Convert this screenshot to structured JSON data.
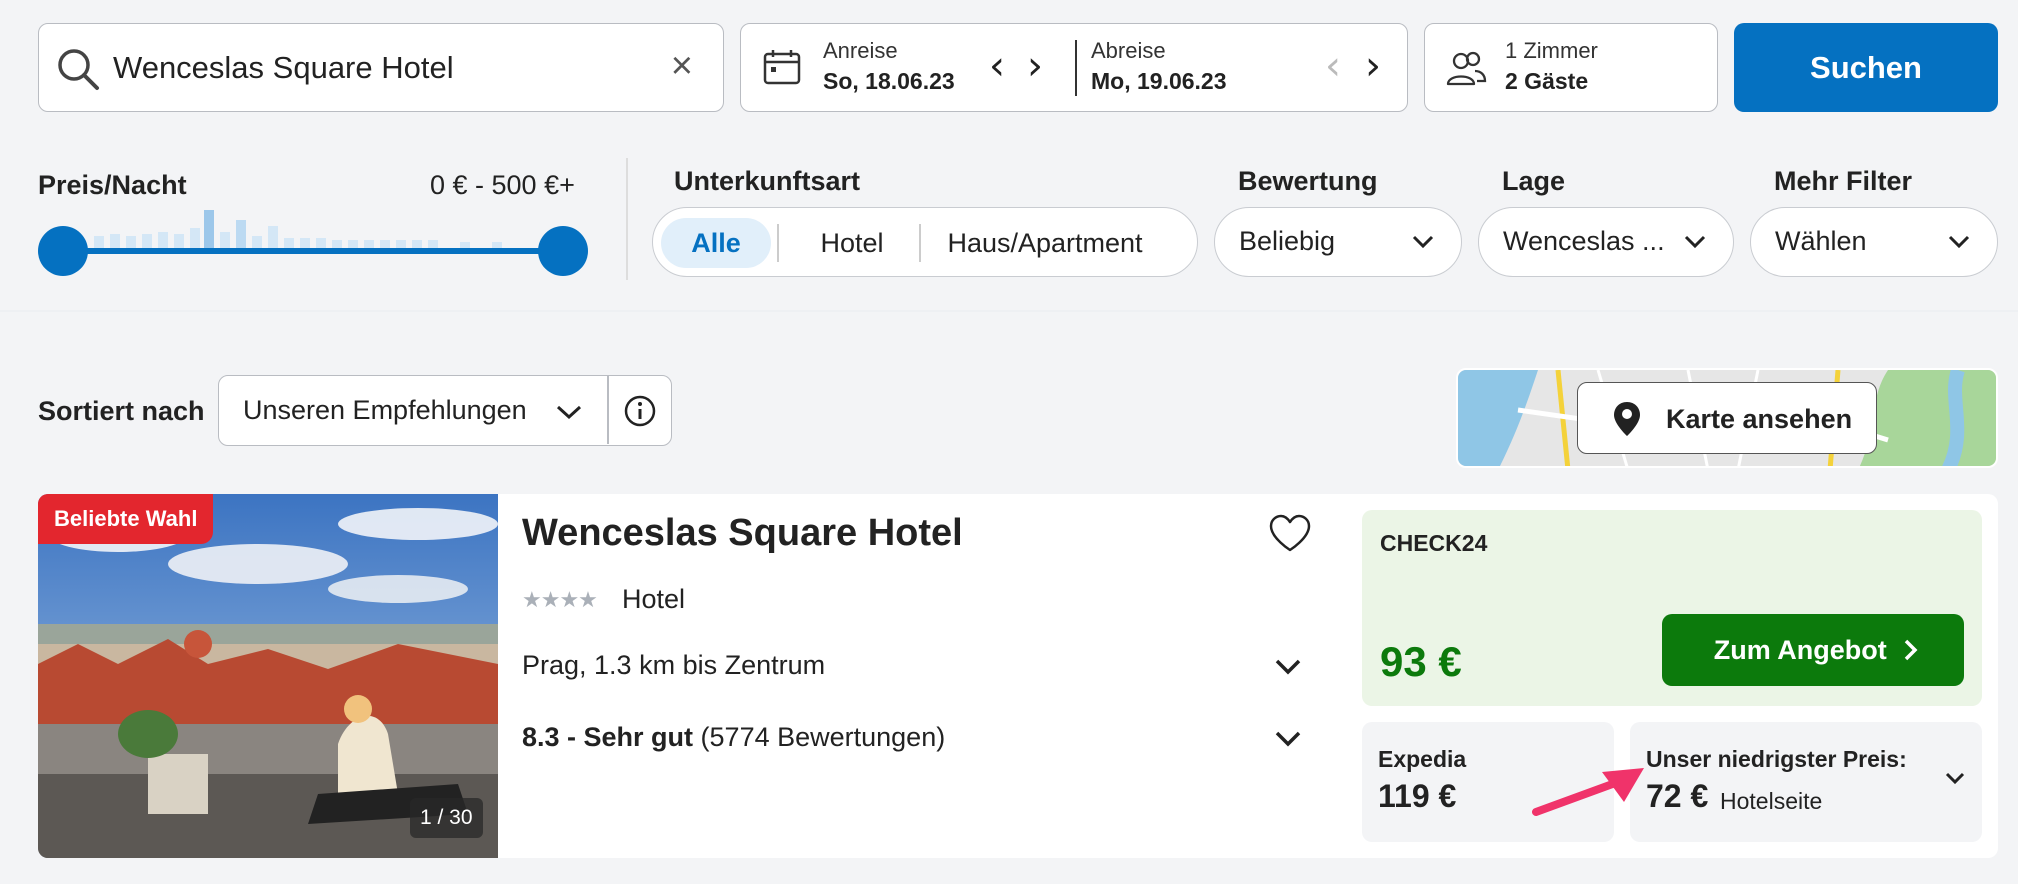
{
  "search": {
    "query": "Wenceslas Square Hotel",
    "clear_label": "×",
    "checkin_label": "Anreise",
    "checkin_value": "So, 18.06.23",
    "checkout_label": "Abreise",
    "checkout_value": "Mo, 19.06.23",
    "rooms": "1 Zimmer",
    "guests": "2 Gäste",
    "submit_label": "Suchen"
  },
  "filters": {
    "price_label": "Preis/Nacht",
    "price_range": "0 € - 500 €+",
    "type_label": "Unterkunftsart",
    "types": [
      "Alle",
      "Hotel",
      "Haus/Apartment"
    ],
    "active_type": "Alle",
    "rating_label": "Bewertung",
    "rating_value": "Beliebig",
    "location_label": "Lage",
    "location_value": "Wenceslas ...",
    "more_label": "Mehr Filter",
    "more_value": "Wählen"
  },
  "sort": {
    "label": "Sortiert nach",
    "value": "Unseren Empfehlungen"
  },
  "map": {
    "button_label": "Karte ansehen"
  },
  "result": {
    "badge": "Beliebte Wahl",
    "photo_counter": "1 / 30",
    "name": "Wenceslas Square Hotel",
    "stars": "★★★★",
    "type": "Hotel",
    "location": "Prag, 1.3 km bis Zentrum",
    "rating_strong": "8.3 - Sehr gut",
    "rating_count": "(5774 Bewertungen)",
    "offer": {
      "provider": "CHECK24",
      "price": "93 €",
      "button_label": "Zum Angebot"
    },
    "alt_offer": {
      "provider": "Expedia",
      "price": "119 €"
    },
    "lowest": {
      "label": "Unser niedrigster Preis:",
      "price": "72 €",
      "source": "Hotelseite"
    }
  },
  "colors": {
    "primary_blue": "#0571c1",
    "offer_green": "#0c7a0c",
    "badge_red": "#e3262e",
    "annotation_pink": "#f0336a"
  }
}
